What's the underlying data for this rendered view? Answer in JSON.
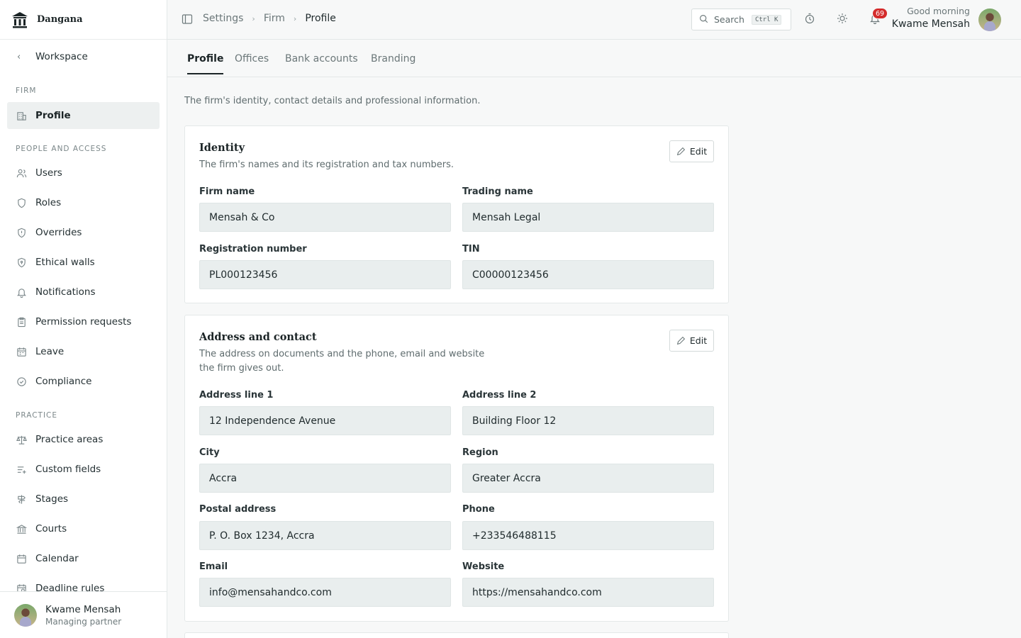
{
  "brand": {
    "name": "Dangana",
    "logo_icon": "scales-building-icon"
  },
  "sidebar": {
    "back_label": "Workspace",
    "sections": [
      {
        "label": "FIRM"
      },
      {
        "label": "PEOPLE AND ACCESS"
      },
      {
        "label": "PRACTICE"
      }
    ],
    "items": [
      {
        "label": "Profile",
        "icon": "building-icon",
        "active": true
      },
      {
        "label": "Users",
        "icon": "users-icon"
      },
      {
        "label": "Roles",
        "icon": "shield-icon"
      },
      {
        "label": "Overrides",
        "icon": "shield-alert-icon"
      },
      {
        "label": "Ethical walls",
        "icon": "shield-lock-icon"
      },
      {
        "label": "Notifications",
        "icon": "bell-icon"
      },
      {
        "label": "Permission requests",
        "icon": "clipboard-icon"
      },
      {
        "label": "Leave",
        "icon": "calendar-icon"
      },
      {
        "label": "Compliance",
        "icon": "check-circle-icon"
      },
      {
        "label": "Practice areas",
        "icon": "scales-icon"
      },
      {
        "label": "Custom fields",
        "icon": "list-plus-icon"
      },
      {
        "label": "Stages",
        "icon": "signpost-icon"
      },
      {
        "label": "Courts",
        "icon": "courthouse-icon"
      },
      {
        "label": "Calendar",
        "icon": "calendar-icon"
      },
      {
        "label": "Deadline rules",
        "icon": "calendar-clock-icon"
      }
    ],
    "user": {
      "name": "Kwame Mensah",
      "role": "Managing partner"
    }
  },
  "topbar": {
    "breadcrumbs": [
      "Settings",
      "Firm",
      "Profile"
    ],
    "search": {
      "label": "Search",
      "shortcut": "Ctrl K"
    },
    "notifications_count": "69",
    "greeting": "Good morning",
    "user_name": "Kwame Mensah"
  },
  "tabs": [
    {
      "label": "Profile",
      "active": true
    },
    {
      "label": "Offices"
    },
    {
      "label": "Bank accounts"
    },
    {
      "label": "Branding"
    }
  ],
  "intro": "The firm's identity, contact details and professional information.",
  "identity": {
    "title": "Identity",
    "description": "The firm's names and its registration and tax numbers.",
    "edit_label": "Edit",
    "fields": [
      {
        "label": "Firm name",
        "value": "Mensah & Co"
      },
      {
        "label": "Trading name",
        "value": "Mensah Legal"
      },
      {
        "label": "Registration number",
        "value": "PL000123456"
      },
      {
        "label": "TIN",
        "value": "C00000123456"
      }
    ]
  },
  "address": {
    "title": "Address and contact",
    "description_line1": "The address on documents and the phone, email and website",
    "description_line2": "the firm gives out.",
    "edit_label": "Edit",
    "fields": [
      {
        "label": "Address line 1",
        "value": "12 Independence Avenue"
      },
      {
        "label": "Address line 2",
        "value": "Building Floor 12"
      },
      {
        "label": "City",
        "value": "Accra"
      },
      {
        "label": "Region",
        "value": "Greater Accra"
      },
      {
        "label": "Postal address",
        "value": "P. O. Box 1234, Accra"
      },
      {
        "label": "Phone",
        "value": "+233546488115"
      },
      {
        "label": "Email",
        "value": "info@mensahandco.com"
      },
      {
        "label": "Website",
        "value": "https://mensahandco.com"
      }
    ]
  },
  "colors": {
    "accent": "#1b2426",
    "badge": "#d42c2c",
    "field_bg": "#e9eeee"
  }
}
